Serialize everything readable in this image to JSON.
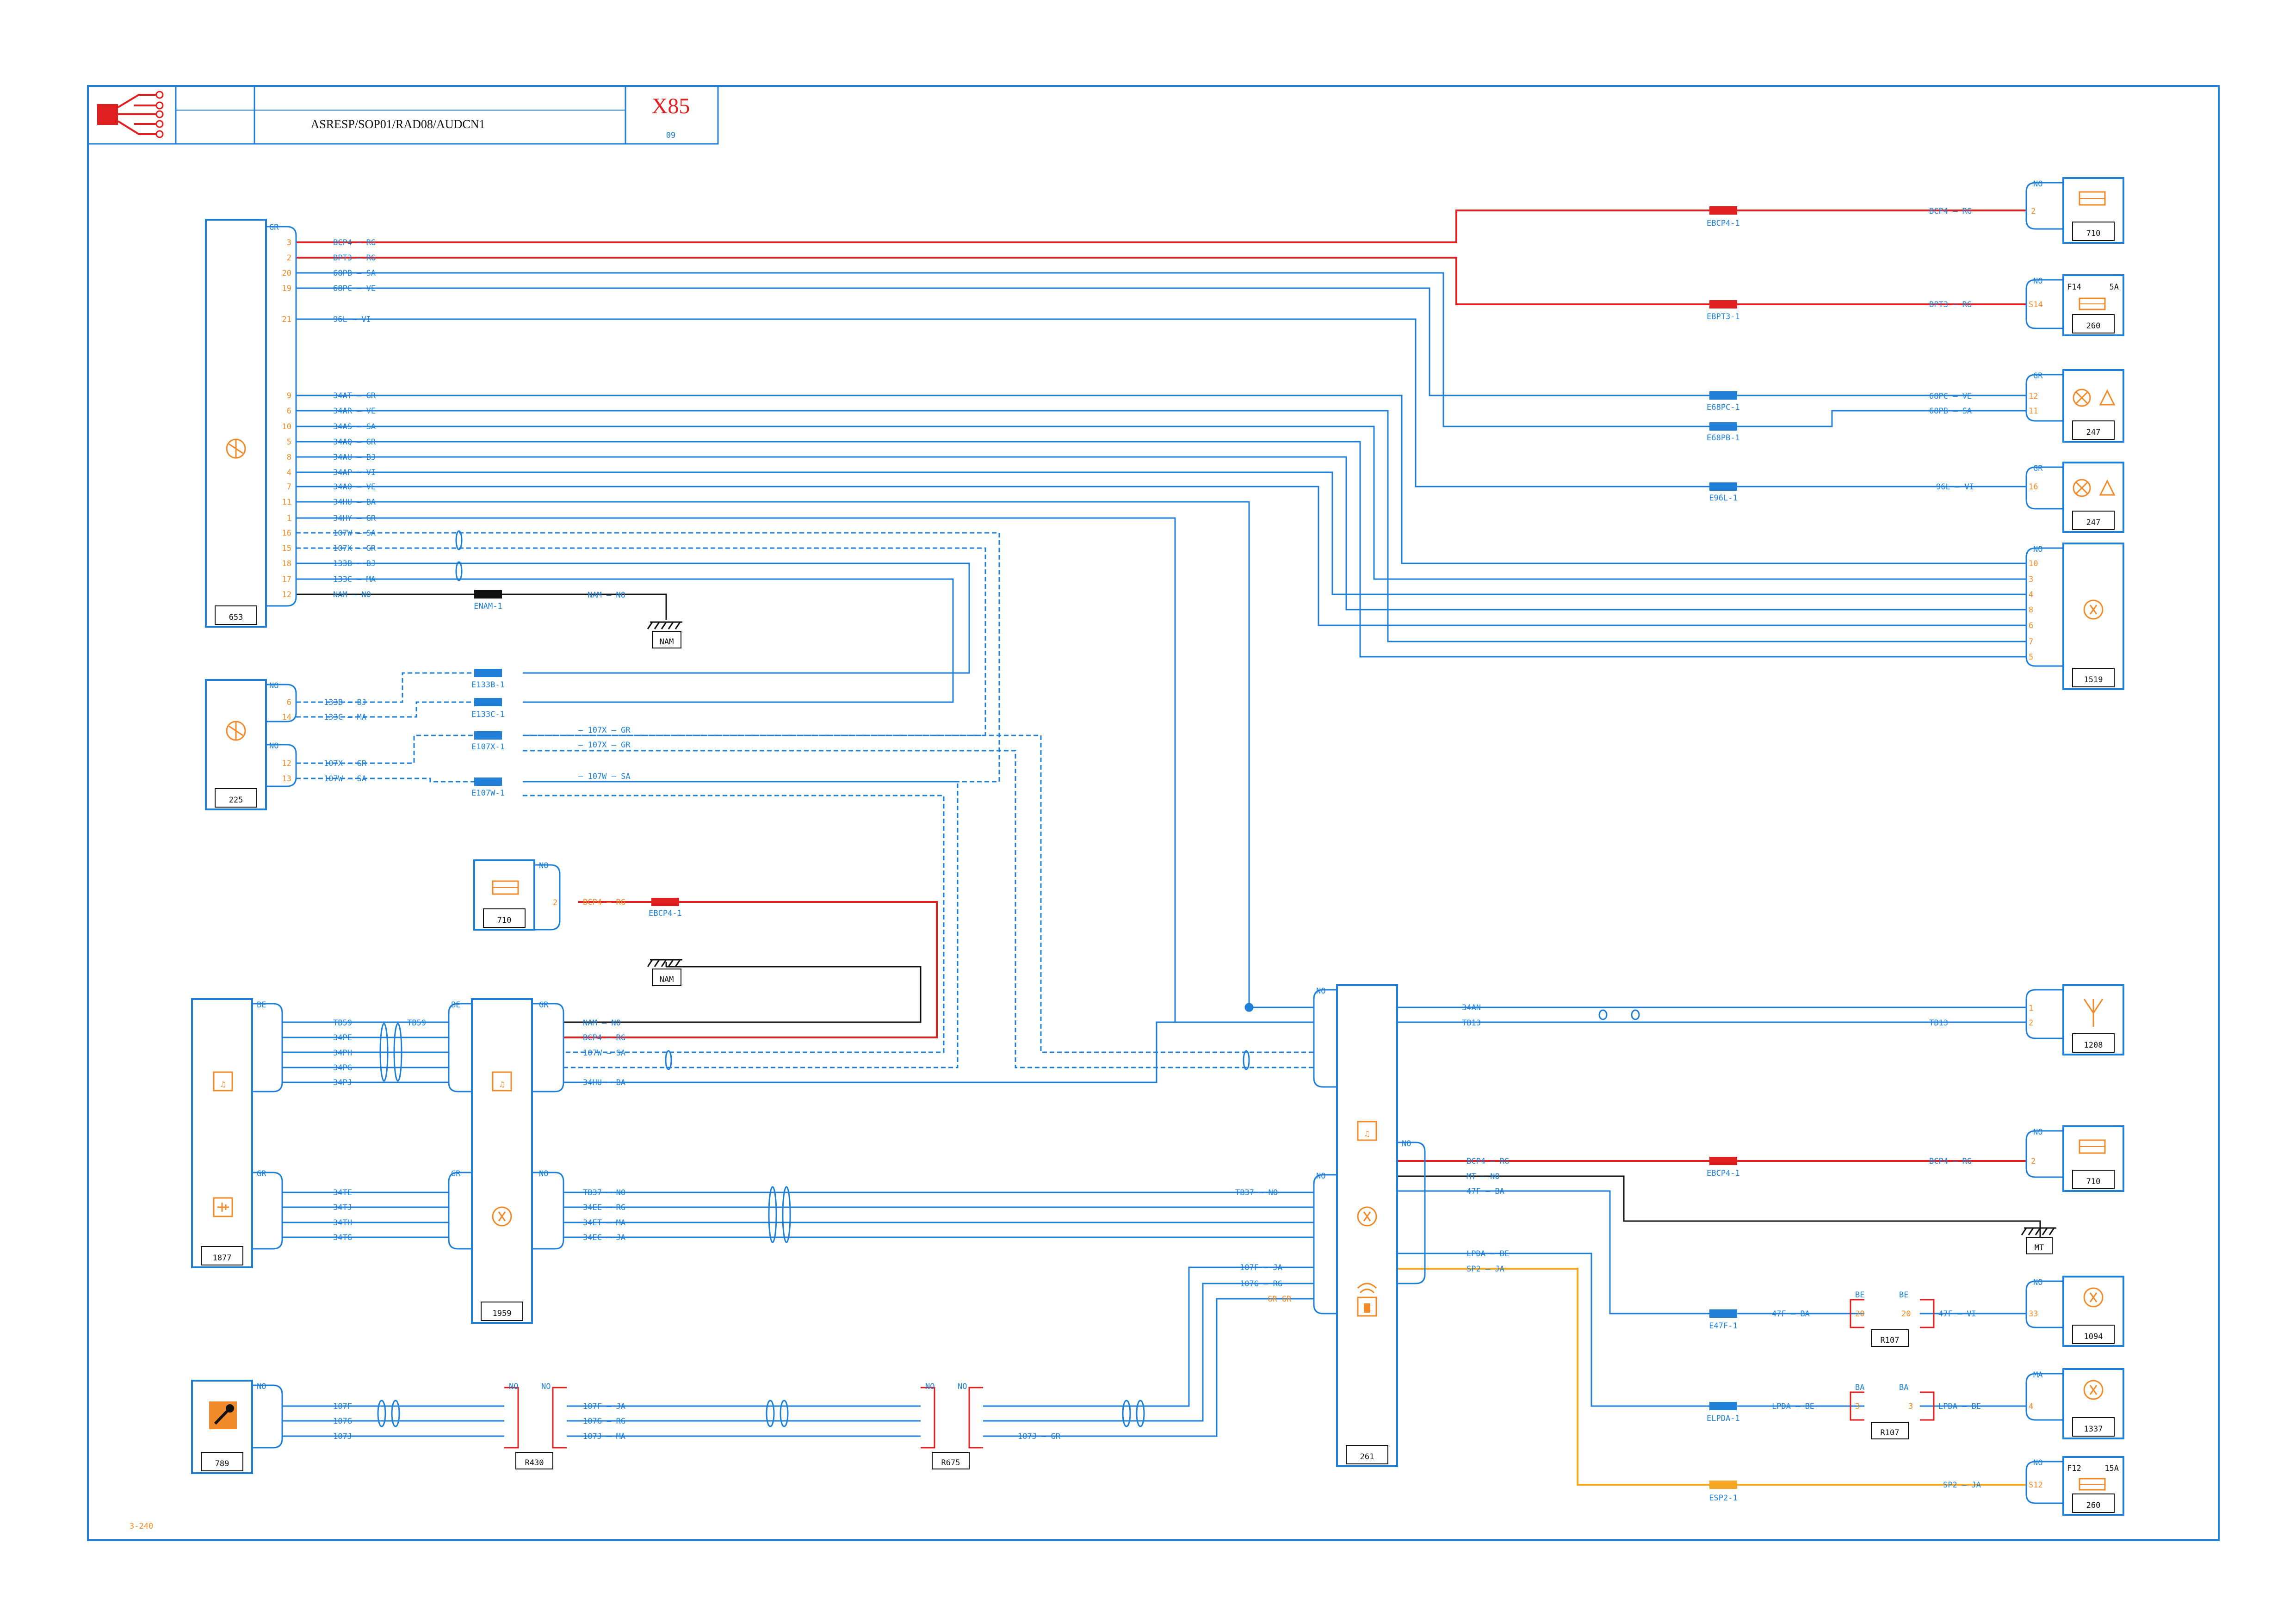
{
  "header": {
    "code": "ASRESP/SOP01/RAD08/AUDCN1",
    "vehicle": "X85",
    "version": "09"
  },
  "footer": {
    "page": "3-240"
  },
  "colors": {
    "frame": "#1f7fd6",
    "red": "#e02020",
    "orange": "#f08a2a",
    "black": "#111111",
    "yellow": "#f5a623",
    "blue": "#1f7fd6"
  },
  "components": {
    "c653": {
      "id": "653",
      "conn": "GR"
    },
    "c225": {
      "id": "225",
      "conn_a": "NO",
      "conn_b": "NO"
    },
    "c710a": {
      "id": "710",
      "conn": "NO"
    },
    "c710b": {
      "id": "710",
      "conn": "NO"
    },
    "c710c": {
      "id": "710",
      "conn": "NO"
    },
    "c260a": {
      "id": "260",
      "conn": "NO",
      "fuse": "F14",
      "amp": "5A",
      "pin": "S14"
    },
    "c260b": {
      "id": "260",
      "conn": "NO",
      "fuse": "F12",
      "amp": "15A",
      "pin": "S12"
    },
    "c247a": {
      "id": "247",
      "conn": "GR"
    },
    "c247b": {
      "id": "247",
      "conn": "GR"
    },
    "c1519": {
      "id": "1519",
      "conn": "NO"
    },
    "c1877": {
      "id": "1877",
      "conn_a": "BE",
      "conn_b": "GR"
    },
    "c1959": {
      "id": "1959",
      "conn_a": "BE",
      "conn_b": "GR",
      "conn_c": "NO",
      "conn_d": "GR"
    },
    "c261": {
      "id": "261",
      "conn_a": "NO",
      "conn_b": "NO",
      "conn_c": "NO"
    },
    "c1208": {
      "id": "1208",
      "conn": ""
    },
    "c1094": {
      "id": "1094",
      "conn": "NO"
    },
    "c1337": {
      "id": "1337",
      "conn": "MA"
    },
    "c789": {
      "id": "789",
      "conn": "NO"
    },
    "r430": {
      "id": "R430",
      "conn_a": "NO",
      "conn_b": "NO"
    },
    "r675": {
      "id": "R675",
      "conn_a": "NO",
      "conn_b": "NO"
    },
    "r107a": {
      "id": "R107",
      "conn_a": "BE",
      "conn_b": "BE",
      "pin_a": "20",
      "pin_b": "20"
    },
    "r107b": {
      "id": "R107",
      "conn_a": "BA",
      "conn_b": "BA",
      "pin_a": "3",
      "pin_b": "3"
    }
  },
  "grounds": {
    "nam1": "NAM",
    "nam2": "NAM",
    "mt": "MT"
  },
  "c653_wires": [
    {
      "pin": "3",
      "wire": "BCP4",
      "col": "RG"
    },
    {
      "pin": "2",
      "wire": "BPT3",
      "col": "RG"
    },
    {
      "pin": "20",
      "wire": "68PB",
      "col": "SA"
    },
    {
      "pin": "19",
      "wire": "68PC",
      "col": "VE"
    },
    {
      "pin": "21",
      "wire": "96L",
      "col": "VI"
    },
    {
      "pin": "9",
      "wire": "34AT",
      "col": "GR"
    },
    {
      "pin": "6",
      "wire": "34AR",
      "col": "VE"
    },
    {
      "pin": "10",
      "wire": "34AS",
      "col": "SA"
    },
    {
      "pin": "5",
      "wire": "34AQ",
      "col": "GR"
    },
    {
      "pin": "8",
      "wire": "34AU",
      "col": "BJ"
    },
    {
      "pin": "4",
      "wire": "34AP",
      "col": "VI"
    },
    {
      "pin": "7",
      "wire": "34AO",
      "col": "VE"
    },
    {
      "pin": "11",
      "wire": "34HU",
      "col": "BA"
    },
    {
      "pin": "1",
      "wire": "34HY",
      "col": "GR"
    },
    {
      "pin": "16",
      "wire": "107W",
      "col": "SA"
    },
    {
      "pin": "15",
      "wire": "107X",
      "col": "GR"
    },
    {
      "pin": "18",
      "wire": "133B",
      "col": "BJ"
    },
    {
      "pin": "17",
      "wire": "133C",
      "col": "MA"
    },
    {
      "pin": "12",
      "wire": "NAM",
      "col": "NO"
    }
  ],
  "c225_wires": [
    {
      "pin": "6",
      "wire": "133B",
      "col": "BJ"
    },
    {
      "pin": "14",
      "wire": "133C",
      "col": "MA"
    },
    {
      "pin": "12",
      "wire": "107X",
      "col": "GR"
    },
    {
      "pin": "13",
      "wire": "107W",
      "col": "SA"
    }
  ],
  "c1519_pins": [
    "10",
    "3",
    "4",
    "8",
    "6",
    "7",
    "5"
  ],
  "c247a_pins": [
    "12",
    "11"
  ],
  "c247b_pins": [
    "16"
  ],
  "right_labels": {
    "bcp4": "BCP4 — RG",
    "bpt3": "BPT3 — RG",
    "p68pc": "68PC — VE",
    "p68pb": "68PB — SA",
    "p96l": "96L — VI",
    "tb13": "TB13",
    "p47f": "47F — VI",
    "lpda": "LPDA — BE",
    "sp2": "SP2 — JA",
    "bcp4b": "BCP4 — RG"
  },
  "splices": {
    "ebcp4_1": "EBCP4-1",
    "ebpt3_1": "EBPT3-1",
    "e68pc_1": "E68PC-1",
    "e68pb_1": "E68PB-1",
    "e96l_1": "E96L-1",
    "enam_1": "ENAM-1",
    "e133b_1": "E133B-1",
    "e133c_1": "E133C-1",
    "e107x_1": "E107X-1",
    "e107w_1": "E107W-1",
    "ebcp4_1b": "EBCP4-1",
    "ebcp4_1c": "EBCP4-1",
    "e47f_1": "E47F-1",
    "elpda_1": "ELPDA-1",
    "esp2_1": "ESP2-1"
  },
  "mid_labels": {
    "nam_no": "NAM — NO",
    "bcp4_rg": "BCP4 — RG",
    "x107_gr": "— 107X — GR",
    "x107_gr2": "— 107X — GR",
    "w107_sa": "— 107W — SA",
    "c1959_nam": "NAM — NO",
    "c1959_bcp4": "BCP4 — RG",
    "c1959_107w": "107W — SA",
    "c1959_34hu": "34HU — BA",
    "tb59a": "TB59",
    "tb59b": "TB59",
    "p34pe": "34PE",
    "p34ph": "34PH",
    "p34pg": "34PG",
    "p34pj": "34PJ",
    "p34te": "34TE",
    "p34tj": "34TJ",
    "p34th": "34TH",
    "p34tg": "34TG",
    "tb37": "TB37 — NO",
    "p34ee": "34EE — RG",
    "p34et": "34ET — MA",
    "p34ec": "34EC — JA",
    "tb37b": "TB37 — NO",
    "s107f": "107F — JA",
    "s107g": "107G — RG",
    "grgr": "GR GR",
    "c789_107f": "107F",
    "c789_107g": "107G",
    "c789_107j": "107J",
    "r430_107f": "107F — JA",
    "r430_107g": "107G — RG",
    "r430_107j": "107J — MA",
    "r675_107j": "107J — GR",
    "p34an": "34AN",
    "tb13": "TB13",
    "a4": "BCP4 — RG",
    "a8": "MT — NO",
    "a1": "47F — BA",
    "a6": "LPDA — BE",
    "a7": "SP2 — JA",
    "r107a_l": "47F — BA",
    "r107b_l": "LPDA — BE",
    "s261_pins": "A4 A8 A1 A6 A7"
  }
}
